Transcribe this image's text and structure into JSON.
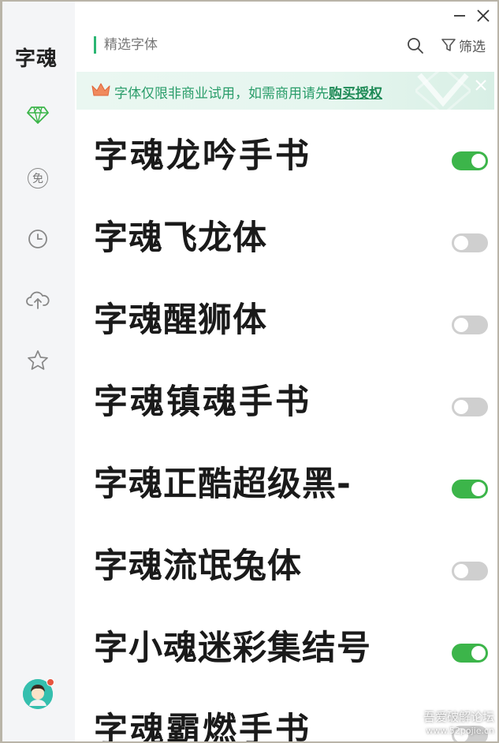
{
  "app": {
    "logo": "字魂"
  },
  "sidebar": {
    "items": [
      {
        "icon": "diamond-icon",
        "active": true
      },
      {
        "icon": "free-icon",
        "label": "免"
      },
      {
        "icon": "clock-icon"
      },
      {
        "icon": "cloud-upload-icon"
      },
      {
        "icon": "star-icon"
      }
    ]
  },
  "header": {
    "title": "精选字体",
    "filter_label": "筛选"
  },
  "banner": {
    "text": "字体仅限非商业试用，如需商用请先",
    "link": "购买授权"
  },
  "fonts": [
    {
      "name": "字魂龙吟手书",
      "enabled": true
    },
    {
      "name": "字魂飞龙体",
      "enabled": false
    },
    {
      "name": "字魂醒狮体",
      "enabled": false
    },
    {
      "name": "字魂镇魂手书",
      "enabled": false
    },
    {
      "name": "字魂正酷超级黑-",
      "enabled": true
    },
    {
      "name": "字魂流氓兔体",
      "enabled": false
    },
    {
      "name": "字小魂迷彩集结号",
      "enabled": true
    },
    {
      "name": "字魂霸燃手书",
      "enabled": false
    }
  ],
  "watermark": {
    "line1": "吾爱破解论坛",
    "line2": "www.52pojie.cn"
  },
  "colors": {
    "accent": "#3cb54a",
    "banner_text": "#2a9d6a",
    "toggle_off": "#cfcfcf"
  }
}
